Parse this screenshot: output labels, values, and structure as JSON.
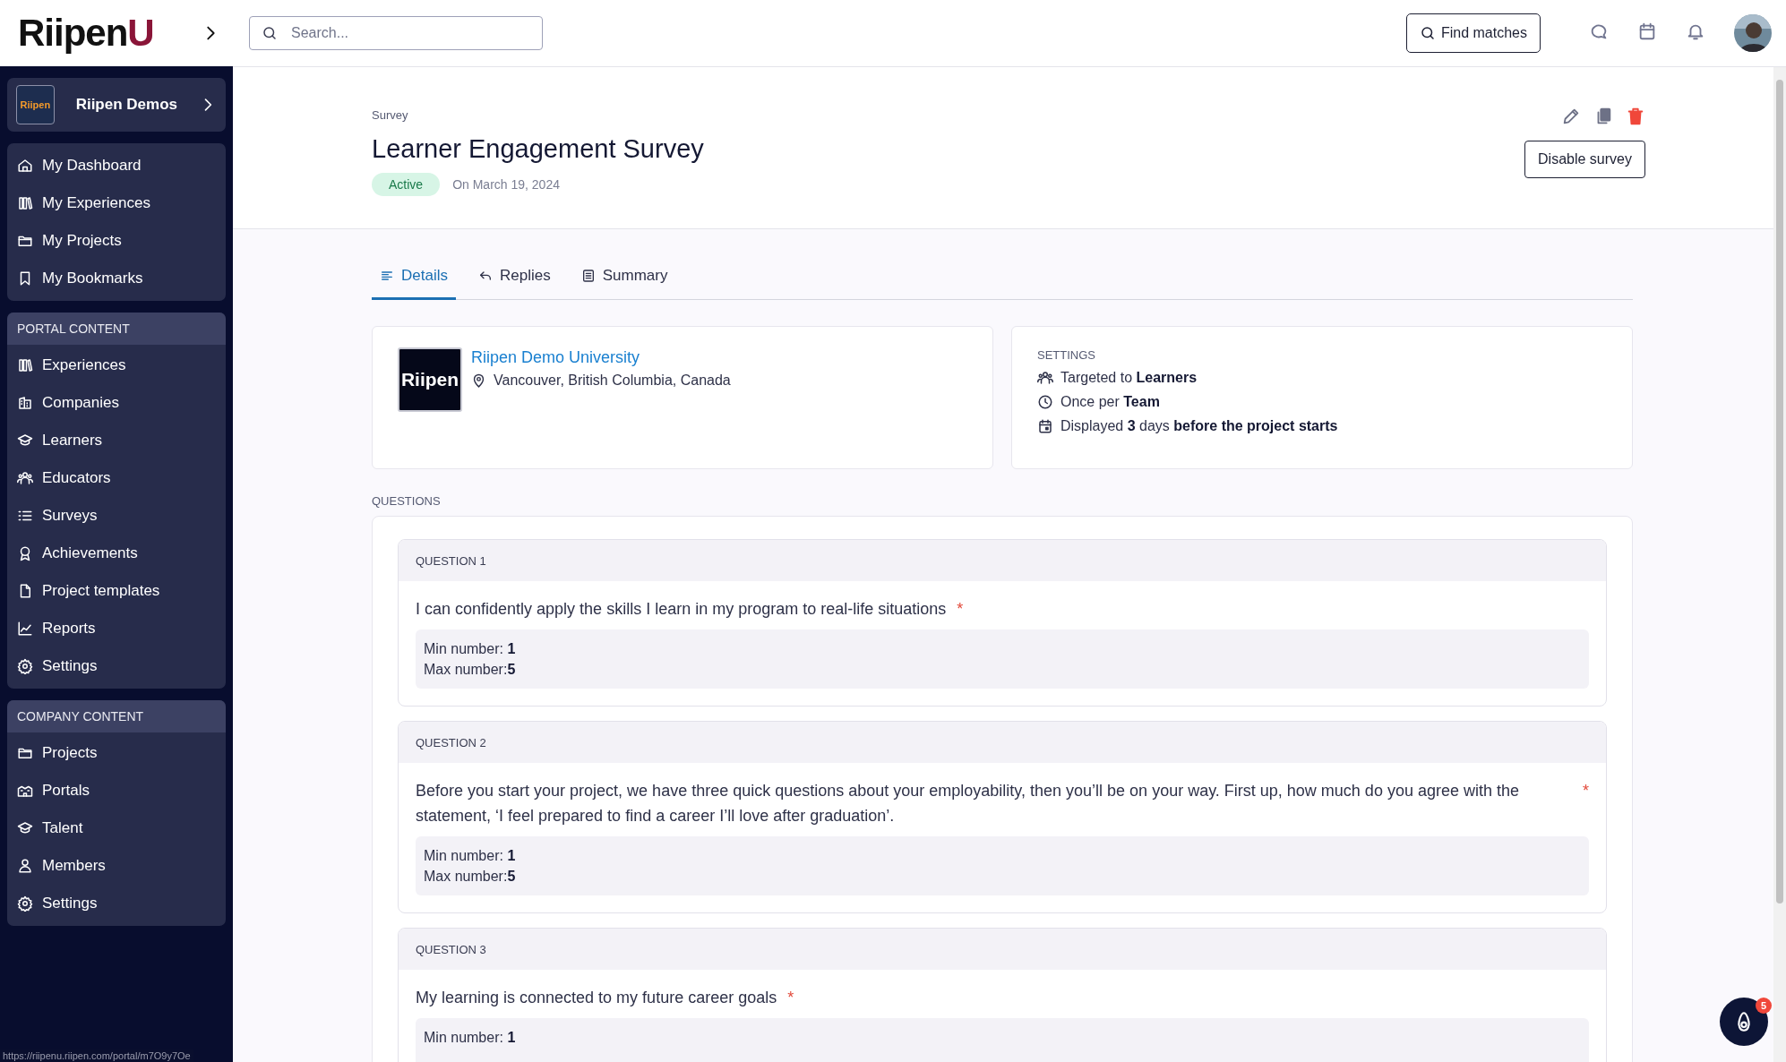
{
  "brand": {
    "name": "Riipen",
    "accent": "U"
  },
  "sidebar": {
    "org": {
      "logo_text": "Riipen",
      "name": "Riipen Demos"
    },
    "groups": [
      {
        "items": [
          {
            "label": "My Dashboard",
            "selected": false
          },
          {
            "label": "My Experiences",
            "selected": false
          },
          {
            "label": "My Projects",
            "selected": false
          },
          {
            "label": "My Bookmarks",
            "selected": false
          }
        ]
      },
      {
        "heading": "PORTAL CONTENT",
        "items": [
          {
            "label": "Experiences",
            "selected": false
          },
          {
            "label": "Companies",
            "selected": false
          },
          {
            "label": "Learners",
            "selected": false
          },
          {
            "label": "Educators",
            "selected": false
          },
          {
            "label": "Surveys",
            "selected": false
          },
          {
            "label": "Achievements",
            "selected": false
          },
          {
            "label": "Project templates",
            "selected": false
          },
          {
            "label": "Reports",
            "selected": false
          },
          {
            "label": "Settings",
            "selected": false
          }
        ]
      },
      {
        "heading": "COMPANY CONTENT",
        "items": [
          {
            "label": "Projects",
            "selected": false
          },
          {
            "label": "Portals",
            "selected": false
          },
          {
            "label": "Talent",
            "selected": false
          },
          {
            "label": "Members",
            "selected": false
          },
          {
            "label": "Settings",
            "selected": false
          }
        ]
      }
    ]
  },
  "topbar": {
    "search": {
      "placeholder": "Search..."
    },
    "find_button": "Find matches"
  },
  "page": {
    "breadcrumb": "Survey",
    "title": "Learner Engagement Survey",
    "status": "Active",
    "date": "On March 19, 2024",
    "disable_button": "Disable survey"
  },
  "tabs": [
    {
      "label": "Details",
      "selected": true
    },
    {
      "label": "Replies",
      "selected": false
    },
    {
      "label": "Summary",
      "selected": false
    }
  ],
  "organization": {
    "logo_text": "Riipen",
    "name": "Riipen Demo University",
    "location": "Vancouver, British Columbia, Canada"
  },
  "settings": {
    "heading": "SETTINGS",
    "lines": [
      "Targeted to **Learners**",
      "Once per **Team**",
      "Displayed **3** days **before the project starts**"
    ]
  },
  "questions_heading": "QUESTIONS",
  "questions": [
    {
      "label": "QUESTION 1",
      "text": "I can confidently apply the skills I learn in my program to real-life situations",
      "required_mark": "*",
      "min": "Min number: **1**",
      "max": "Max number:**5**"
    },
    {
      "label": "QUESTION 2",
      "text": "Before you start your project, we have three quick questions about your employability, then you’ll be on your way. First up, how much do you agree with the statement, ‘I feel prepared to find a career I’ll love after graduation’.",
      "required_mark": "*",
      "min": "Min number: **1**",
      "max": "Max number:**5**"
    },
    {
      "label": "QUESTION 3",
      "text": "My learning is connected to my future career goals",
      "required_mark": "*",
      "min": "Min number: **1**"
    }
  ],
  "chat_badge": "5",
  "status_url": "https://riipenu.riipen.com/portal/m7O9y7Oe"
}
